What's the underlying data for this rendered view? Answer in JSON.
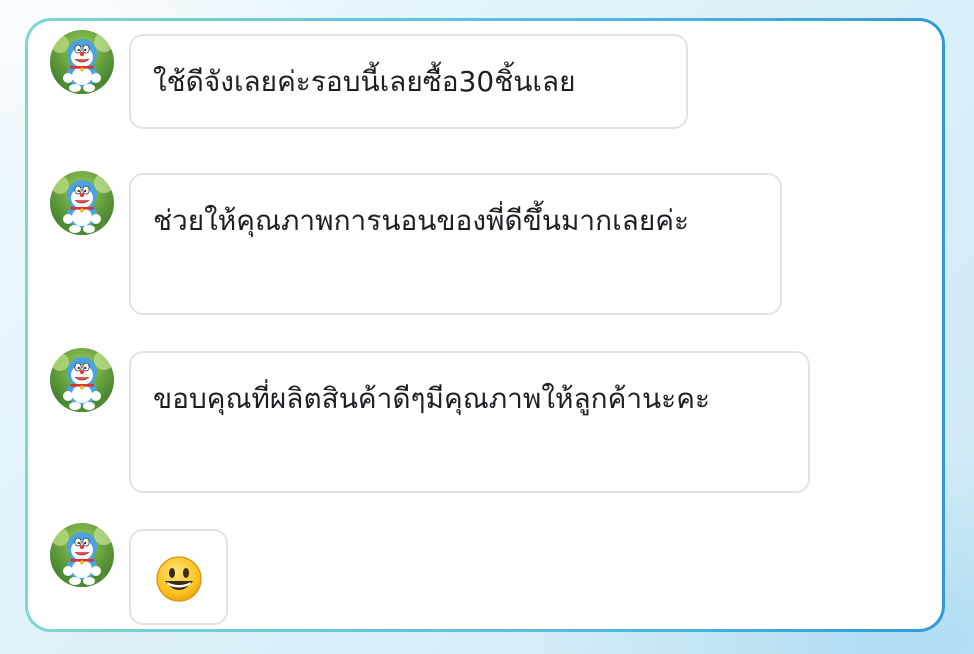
{
  "messages": [
    {
      "text": "ใช้ดีจังเลยค่ะรอบนี้เลยซื้อ30ชิ้นเลย"
    },
    {
      "text": "ช่วยให้คุณภาพการนอนของพี่ดีขึ้นมากเลยค่ะ"
    },
    {
      "text": "ขอบคุณที่ผลิตสินค้าดีๆมีคุณภาพให้ลูกค้านะคะ"
    },
    {
      "emoji": "smiling-face-emoji"
    }
  ],
  "avatar": {
    "icon": "doraemon-plush-avatar-icon"
  },
  "colors": {
    "frame_border_start": "#7fd6cf",
    "frame_border_end": "#2f9ad9",
    "bubble_border": "#e2e3e6",
    "text": "#1d1f24",
    "emoji_face": "#f9c21c"
  }
}
